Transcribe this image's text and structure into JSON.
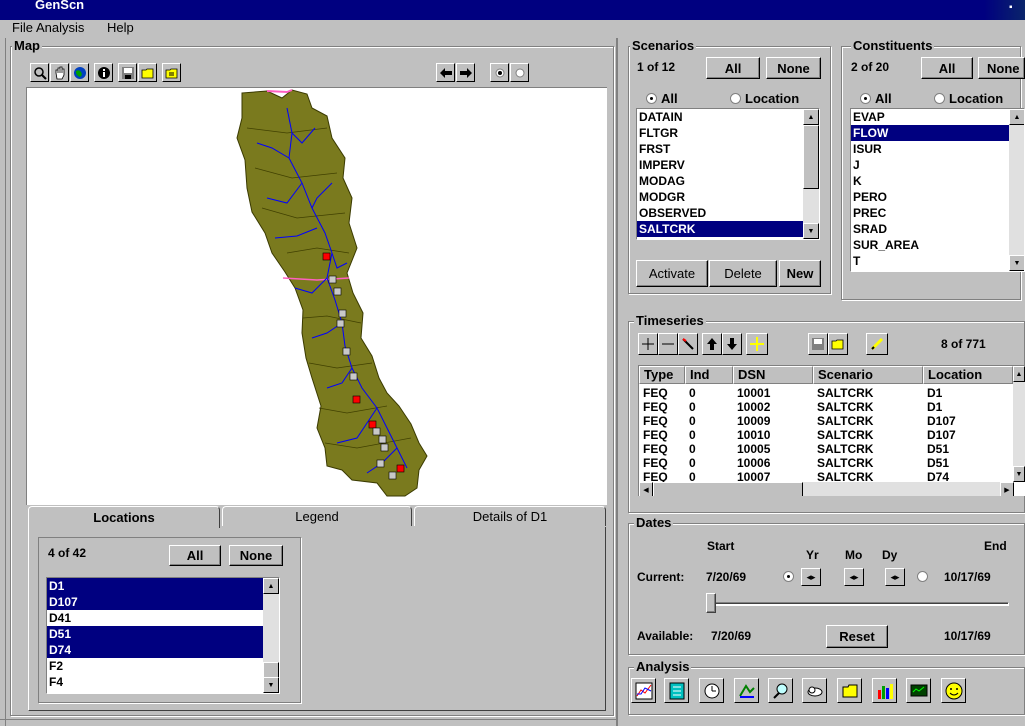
{
  "app": {
    "title": "GenScn"
  },
  "menu": {
    "file": "File",
    "analysis": "Analysis",
    "help": "Help"
  },
  "map": {
    "title": "Map",
    "tools": [
      "zoom-icon",
      "pan-hand-icon",
      "globe-icon",
      "info-icon",
      "save-icon",
      "open-folder-icon",
      "layers-folder-icon"
    ],
    "nav": [
      "back-arrow-icon",
      "forward-arrow-icon",
      "radio-filled-icon",
      "radio-empty-icon"
    ],
    "colors": {
      "basin": "#7a7a1e",
      "stream": "#0000ff",
      "station_red": "#ff0000",
      "station_gray": "#c8c8c8"
    }
  },
  "scenarios": {
    "title": "Scenarios",
    "count": "1 of 12",
    "all": "All",
    "none": "None",
    "radio_all": "All",
    "radio_location": "Location",
    "items": [
      "DATAIN",
      "FLTGR",
      "FRST",
      "IMPERV",
      "MODAG",
      "MODGR",
      "OBSERVED",
      "SALTCRK"
    ],
    "selected_index": 7,
    "activate": "Activate",
    "delete": "Delete",
    "new": "New"
  },
  "constituents": {
    "title": "Constituents",
    "count": "2 of 20",
    "all": "All",
    "none": "None",
    "radio_all": "All",
    "radio_location": "Location",
    "items": [
      "EVAP",
      "FLOW",
      "ISUR",
      "J",
      "K",
      "PERO",
      "PREC",
      "SRAD",
      "SUR_AREA",
      "T"
    ],
    "selected_index": 1
  },
  "timeseries": {
    "title": "Timeseries",
    "count": "8 of 771",
    "columns": [
      "Type",
      "Ind",
      "DSN",
      "Scenario",
      "Location"
    ],
    "rows": [
      [
        "FEQ",
        "0",
        "10001",
        "SALTCRK",
        "D1"
      ],
      [
        "FEQ",
        "0",
        "10002",
        "SALTCRK",
        "D1"
      ],
      [
        "FEQ",
        "0",
        "10009",
        "SALTCRK",
        "D107"
      ],
      [
        "FEQ",
        "0",
        "10010",
        "SALTCRK",
        "D107"
      ],
      [
        "FEQ",
        "0",
        "10005",
        "SALTCRK",
        "D51"
      ],
      [
        "FEQ",
        "0",
        "10006",
        "SALTCRK",
        "D51"
      ],
      [
        "FEQ",
        "0",
        "10007",
        "SALTCRK",
        "D74"
      ]
    ]
  },
  "dates": {
    "title": "Dates",
    "start": "Start",
    "end": "End",
    "yr": "Yr",
    "mo": "Mo",
    "dy": "Dy",
    "current_label": "Current:",
    "current_start": "7/20/69",
    "current_end": "10/17/69",
    "available_label": "Available:",
    "available_start": "7/20/69",
    "available_end": "10/17/69",
    "reset": "Reset"
  },
  "analysis": {
    "title": "Analysis",
    "tools": [
      "graph-icon",
      "list-icon",
      "clock-icon",
      "generate-icon",
      "search-icon",
      "cloud-icon",
      "folder-icon",
      "bar-chart-icon",
      "monitor-icon",
      "smiley-icon"
    ]
  },
  "locations": {
    "tabs": [
      "Locations",
      "Legend",
      "Details of D1"
    ],
    "count": "4 of 42",
    "all": "All",
    "none": "None",
    "items": [
      "D1",
      "D107",
      "D41",
      "D51",
      "D74",
      "F2",
      "F4"
    ],
    "selected": [
      0,
      1,
      3,
      4
    ]
  }
}
